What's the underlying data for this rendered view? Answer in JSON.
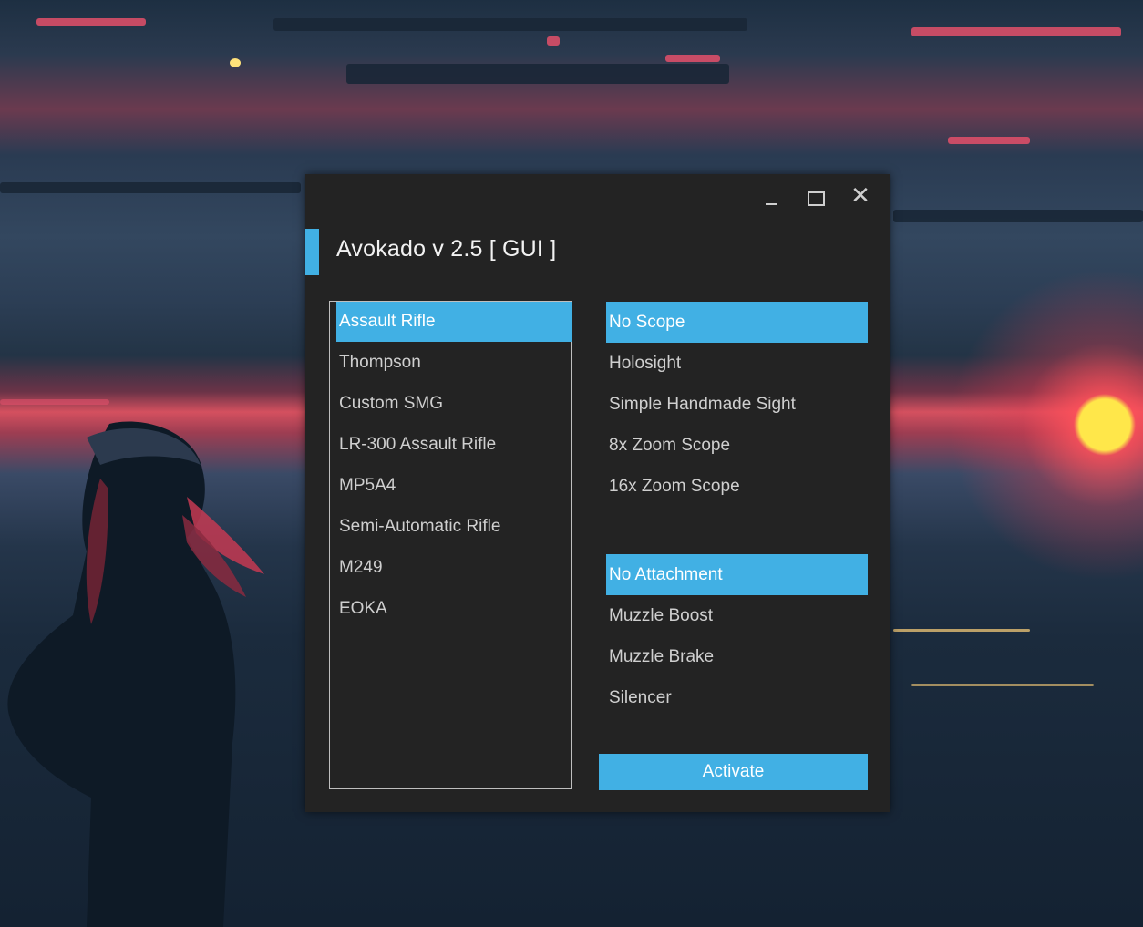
{
  "window": {
    "title": "Avokado v 2.5 [ GUI ]",
    "controls": {
      "minimize": "_",
      "maximize": "",
      "close": "✕"
    }
  },
  "weapons": {
    "selected_index": 0,
    "items": [
      "Assault Rifle",
      "Thompson",
      "Custom SMG",
      "LR-300 Assault Rifle",
      "MP5A4",
      "Semi-Automatic Rifle",
      "M249",
      "EOKA"
    ]
  },
  "scopes": {
    "selected_index": 0,
    "items": [
      "No Scope",
      "Holosight",
      "Simple Handmade Sight",
      "8x Zoom Scope",
      "16x Zoom Scope"
    ]
  },
  "attachments": {
    "selected_index": 0,
    "items": [
      "No Attachment",
      "Muzzle Boost",
      "Muzzle Brake",
      "Silencer"
    ]
  },
  "activate_label": "Activate",
  "colors": {
    "accent": "#41b0e4",
    "window_bg": "#232323",
    "text": "#cfcfcf"
  }
}
